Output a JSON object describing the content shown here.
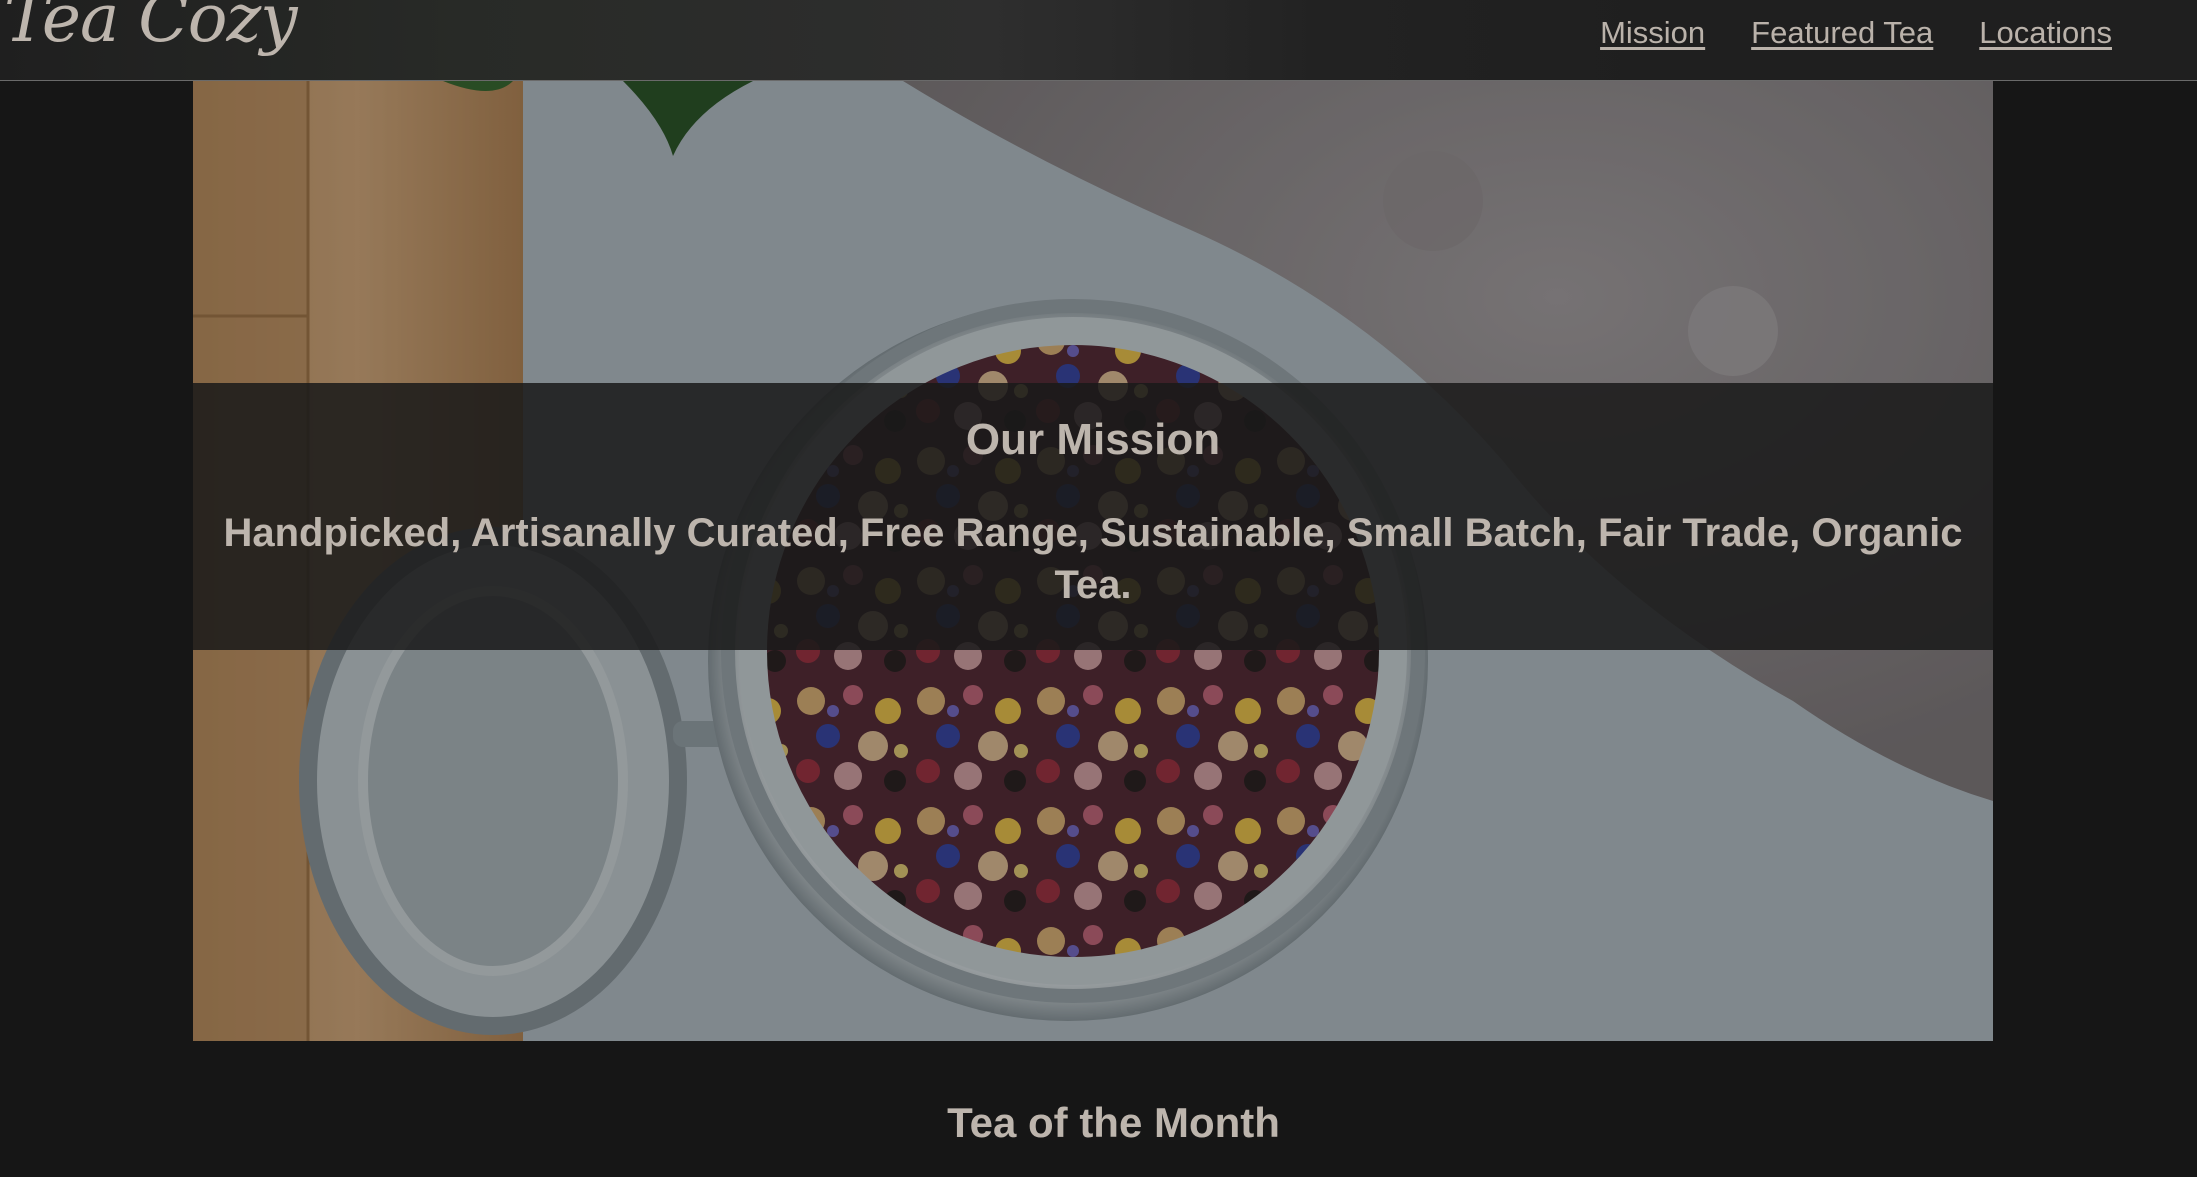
{
  "site": {
    "logo": "Tea Cozy"
  },
  "nav": {
    "items": [
      "Mission",
      "Featured Tea",
      "Locations"
    ]
  },
  "hero": {
    "image_alt": "jar of loose leaf tea",
    "mission_title": "Our Mission",
    "mission_text": "Handpicked, Artisanally Curated, Free Range, Sustainable, Small Batch, Fair Trade, Organic Tea."
  },
  "sections": {
    "tea_of_month_title": "Tea of the Month"
  },
  "colors": {
    "page_background": "#161616",
    "text": "#bdb5ad",
    "header_border": "#6a6a6a"
  }
}
